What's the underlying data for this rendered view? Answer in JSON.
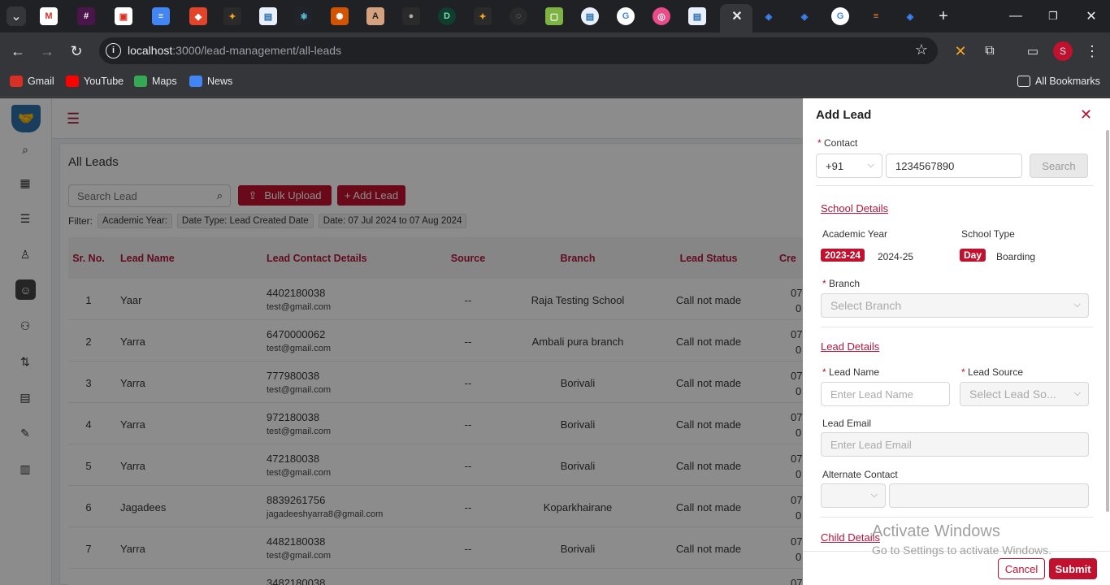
{
  "browser": {
    "url_host": "localhost",
    "url_path": ":3000/lead-management/all-leads",
    "bookmarks": [
      "Gmail",
      "YouTube",
      "Maps",
      "News"
    ],
    "all_bookmarks": "All Bookmarks",
    "profile_initial": "S"
  },
  "app": {
    "page_title": "All Leads",
    "search_placeholder": "Search Lead",
    "bulk_upload": "Bulk Upload",
    "add_lead": "+ Add Lead",
    "filter_label": "Filter:",
    "filters": [
      "Academic Year:",
      "Date Type: Lead Created Date",
      "Date: 07 Jul 2024 to 07 Aug 2024"
    ],
    "columns": [
      "Sr. No.",
      "Lead Name",
      "Lead Contact Details",
      "Source",
      "Branch",
      "Lead Status",
      "Cre"
    ],
    "rows": [
      {
        "sr": "1",
        "name": "Yaar",
        "phone": "4402180038",
        "email": "test@gmail.com",
        "source": "--",
        "branch": "Raja Testing School",
        "status": "Call not made",
        "created1": "07",
        "created2": "0"
      },
      {
        "sr": "2",
        "name": "Yarra",
        "phone": "6470000062",
        "email": "test@gmail.com",
        "source": "--",
        "branch": "Ambali pura branch",
        "status": "Call not made",
        "created1": "07",
        "created2": "0"
      },
      {
        "sr": "3",
        "name": "Yarra",
        "phone": "777980038",
        "email": "test@gmail.com",
        "source": "--",
        "branch": "Borivali",
        "status": "Call not made",
        "created1": "07",
        "created2": "0"
      },
      {
        "sr": "4",
        "name": "Yarra",
        "phone": "972180038",
        "email": "test@gmail.com",
        "source": "--",
        "branch": "Borivali",
        "status": "Call not made",
        "created1": "07",
        "created2": "0"
      },
      {
        "sr": "5",
        "name": "Yarra",
        "phone": "472180038",
        "email": "test@gmail.com",
        "source": "--",
        "branch": "Borivali",
        "status": "Call not made",
        "created1": "07",
        "created2": "0"
      },
      {
        "sr": "6",
        "name": "Jagadees",
        "phone": "8839261756",
        "email": "jagadeeshyarra8@gmail.com",
        "source": "--",
        "branch": "Koparkhairane",
        "status": "Call not made",
        "created1": "07",
        "created2": "0"
      },
      {
        "sr": "7",
        "name": "Yarra",
        "phone": "4482180038",
        "email": "test@gmail.com",
        "source": "--",
        "branch": "Borivali",
        "status": "Call not made",
        "created1": "07",
        "created2": "0"
      },
      {
        "sr": "",
        "name": "",
        "phone": "3482180038",
        "email": "",
        "source": "",
        "branch": "",
        "status": "",
        "created1": "07",
        "created2": ""
      }
    ]
  },
  "drawer": {
    "title": "Add Lead",
    "contact_label": "Contact",
    "country_code": "+91",
    "contact_value": "1234567890",
    "search_button": "Search",
    "school_details": "School Details",
    "academic_year_label": "Academic Year",
    "academic_year_selected": "2023-24",
    "academic_year_other": "2024-25",
    "school_type_label": "School Type",
    "school_type_selected": "Day",
    "school_type_other": "Boarding",
    "branch_label": "Branch",
    "branch_placeholder": "Select Branch",
    "lead_details": "Lead Details",
    "lead_name_label": "Lead Name",
    "lead_name_placeholder": "Enter Lead Name",
    "lead_source_label": "Lead Source",
    "lead_source_placeholder": "Select Lead So...",
    "lead_email_label": "Lead Email",
    "lead_email_placeholder": "Enter Lead Email",
    "alternate_contact_label": "Alternate Contact",
    "child_details": "Child Details",
    "cancel": "Cancel",
    "submit": "Submit",
    "required_mark": "*"
  },
  "watermark": {
    "line1": "Activate Windows",
    "line2": "Go to Settings to activate Windows."
  },
  "colors": {
    "accent": "#c0112f",
    "header_text": "#b3163a"
  }
}
